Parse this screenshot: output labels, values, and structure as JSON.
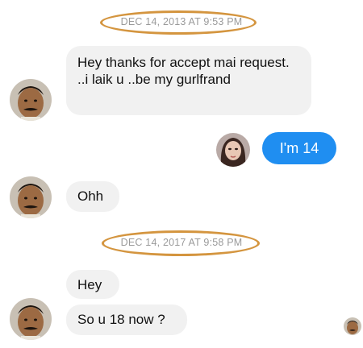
{
  "timestamps": [
    {
      "label": "DEC 14, 2013 AT 9:53 PM"
    },
    {
      "label": "DEC 14, 2017 AT 9:58 PM"
    }
  ],
  "messages": [
    {
      "sender": "him",
      "text": "Hey thanks for accept mai request. ..i laik u ..be my gurlfrand"
    },
    {
      "sender": "her",
      "text": "I'm 14"
    },
    {
      "sender": "him",
      "text": "Ohh"
    },
    {
      "sender": "him",
      "text": "Hey"
    },
    {
      "sender": "him",
      "text": "So u 18 now ?"
    }
  ],
  "colors": {
    "outgoing_bubble": "#1f8ef1",
    "incoming_bubble": "#f1f1f1",
    "highlight_ring": "#d4953f",
    "timestamp_text": "#9a9a9a"
  }
}
